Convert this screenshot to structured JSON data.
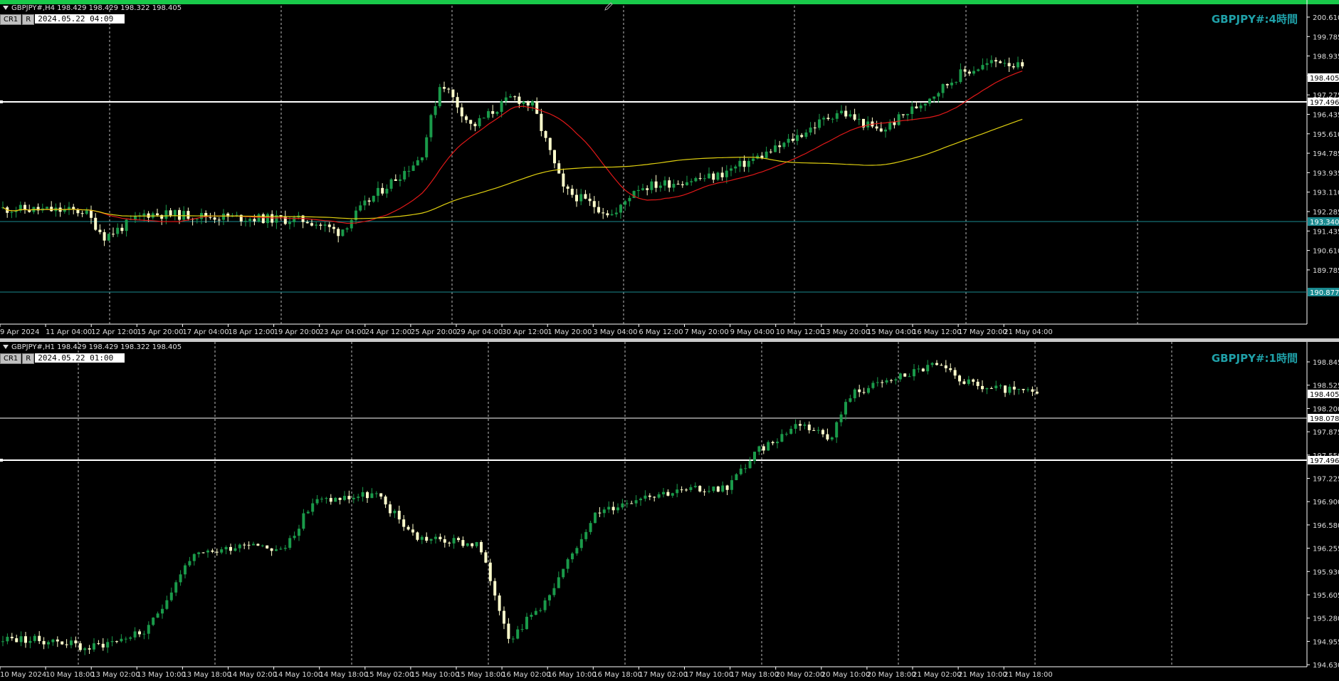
{
  "top_chart": {
    "title": "GBPJPY#,H4  198.429 198.429 198.322 198.405",
    "badge1": "CR1",
    "badge2": "R",
    "date": "2024.05.22 04:00",
    "label": "GBPJPY#:4時間",
    "price_labels": [
      "200.610",
      "199.785",
      "198.935",
      "198.110",
      "197.275",
      "196.435",
      "195.610",
      "194.785",
      "193.935",
      "193.110",
      "192.285",
      "191.435",
      "190.610",
      "189.785"
    ],
    "tags": [
      "198.405",
      "197.496",
      "193.340",
      "190.877"
    ],
    "time_labels": [
      "9 Apr 2024",
      "11 Apr 04:00",
      "12 Apr 12:00",
      "15 Apr 20:00",
      "17 Apr 04:00",
      "18 Apr 12:00",
      "19 Apr 20:00",
      "23 Apr 04:00",
      "24 Apr 12:00",
      "25 Apr 20:00",
      "29 Apr 04:00",
      "30 Apr 12:00",
      "1 May 20:00",
      "3 May 04:00",
      "6 May 12:00",
      "7 May 20:00",
      "9 May 04:00",
      "10 May 12:00",
      "13 May 20:00",
      "15 May 04:00",
      "16 May 12:00",
      "17 May 20:00",
      "21 May 04:00"
    ]
  },
  "bottom_chart": {
    "title": "GBPJPY#,H1  198.429 198.429 198.322 198.405",
    "badge1": "CR1",
    "badge2": "R",
    "date": "2024.05.22 01:00",
    "label": "GBPJPY#:1時間",
    "price_labels": [
      "198.845",
      "198.525",
      "198.200",
      "197.875",
      "197.550",
      "197.225",
      "196.900",
      "196.580",
      "196.255",
      "195.930",
      "195.605",
      "195.280",
      "194.955",
      "194.630"
    ],
    "tags": [
      "198.405",
      "198.078",
      "197.496"
    ],
    "time_labels": [
      "10 May 2024",
      "10 May 18:00",
      "13 May 02:00",
      "13 May 10:00",
      "13 May 18:00",
      "14 May 02:00",
      "14 May 10:00",
      "14 May 18:00",
      "15 May 02:00",
      "15 May 10:00",
      "15 May 18:00",
      "16 May 02:00",
      "16 May 10:00",
      "16 May 18:00",
      "17 May 02:00",
      "17 May 10:00",
      "17 May 18:00",
      "20 May 02:00",
      "20 May 10:00",
      "20 May 18:00",
      "21 May 02:00",
      "21 May 10:00",
      "21 May 18:00"
    ]
  },
  "colors": {
    "bull": "#1a9a4a",
    "bear": "#ffffcc",
    "ma_fast": "#e01818",
    "ma_slow": "#e0d010",
    "teal": "#1fa0a8"
  }
}
